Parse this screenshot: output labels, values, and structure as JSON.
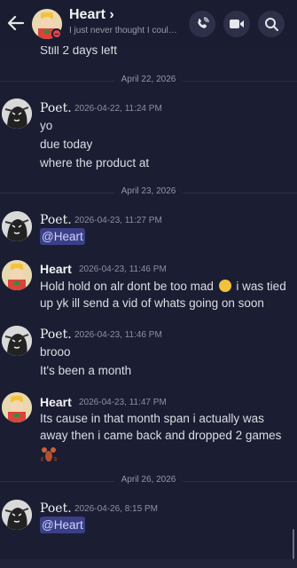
{
  "header": {
    "name": "Heart",
    "chevron": "›",
    "status": "I just never thought I could…",
    "presence_color": "#e0434a",
    "icons": [
      "back-arrow-icon",
      "phone-call-icon",
      "video-call-icon",
      "search-icon"
    ]
  },
  "previous_message": "Still 2 days left",
  "dividers": {
    "d1": "April 22, 2026",
    "d2": "April 23, 2026",
    "d3": "April 26, 2026"
  },
  "messages": [
    {
      "author": "Poet.",
      "timestamp": "2026-04-22, 11:24 PM",
      "lines": [
        "yo",
        "due today",
        "where the product at"
      ]
    },
    {
      "author": "Poet.",
      "timestamp": "2026-04-23, 11:27 PM",
      "mention": "@Heart"
    },
    {
      "author": "Heart",
      "timestamp": "2026-04-23, 11:46 PM",
      "text_before_emoji": "Hold hold on alr dont be too mad",
      "text_after_emoji": "i was tied up yk ill send a vid of whats going on soon",
      "emoji": "loudly-crying-face-emoji"
    },
    {
      "author": "Poet.",
      "timestamp": "2026-04-23, 11:46 PM",
      "lines": [
        "brooo",
        "It's been a month"
      ]
    },
    {
      "author": "Heart",
      "timestamp": "2026-04-23, 11:47 PM",
      "text": "Its cause in that month span i actually was away then i came back and dropped 2 games",
      "sticker": "lobster-sticker"
    },
    {
      "author": "Poet.",
      "timestamp": "2026-04-26, 8:15 PM",
      "mention": "@Heart"
    }
  ],
  "colors": {
    "background": "#1b1d33",
    "mention_bg": "#3b3f86",
    "mention_text": "#cfd4ff"
  }
}
